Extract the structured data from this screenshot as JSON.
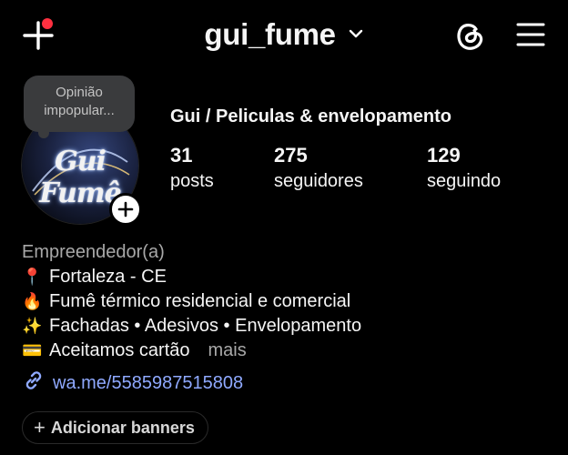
{
  "header": {
    "username": "gui_fume",
    "icons": [
      "add-create-icon",
      "chevron-down-icon",
      "threads-icon",
      "hamburger-menu-icon"
    ],
    "notification_dot_color": "#ff3040"
  },
  "note": {
    "text": "Opinião impopular..."
  },
  "profile": {
    "avatar_text": "Gui Fumê",
    "full_name": "Gui / Peliculas & envelopamento",
    "stats": [
      {
        "value": "31",
        "label": "posts"
      },
      {
        "value": "275",
        "label": "seguidores"
      },
      {
        "value": "129",
        "label": "seguindo"
      }
    ]
  },
  "bio": {
    "category": "Empreendedor(a)",
    "lines": [
      {
        "emoji": "📍",
        "text": "Fortaleza - CE"
      },
      {
        "emoji": "🔥",
        "text": "Fumê térmico residencial e comercial"
      },
      {
        "emoji": "✨",
        "text": "Fachadas • Adesivos • Envelopamento"
      },
      {
        "emoji": "💳",
        "text": "Aceitamos cartão"
      }
    ],
    "more_label": "mais",
    "link": "wa.me/5585987515808",
    "link_color": "#8fa9ff"
  },
  "actions": {
    "add_banners_label": "Adicionar banners"
  }
}
